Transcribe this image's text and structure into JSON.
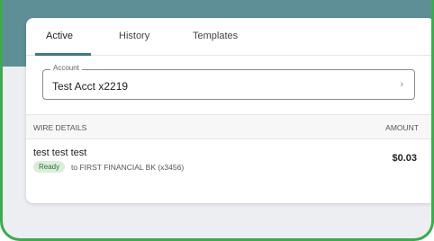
{
  "tabs": [
    {
      "label": "Active",
      "selected": true
    },
    {
      "label": "History",
      "selected": false
    },
    {
      "label": "Templates",
      "selected": false
    }
  ],
  "account": {
    "legend": "Account",
    "value": "Test Acct x2219",
    "icon": "chevron-right-icon"
  },
  "details": {
    "header_left": "WIRE DETAILS",
    "header_right": "AMOUNT"
  },
  "wires": [
    {
      "name": "test test test",
      "status": "Ready",
      "destination": "to FIRST FINANCIAL BK (x3456)",
      "amount": "$0.03"
    }
  ],
  "colors": {
    "header_band": "#5e8f96",
    "tab_underline": "#3d7a82",
    "status_badge_bg": "#dceedb",
    "outline_green": "#3daa4e"
  }
}
